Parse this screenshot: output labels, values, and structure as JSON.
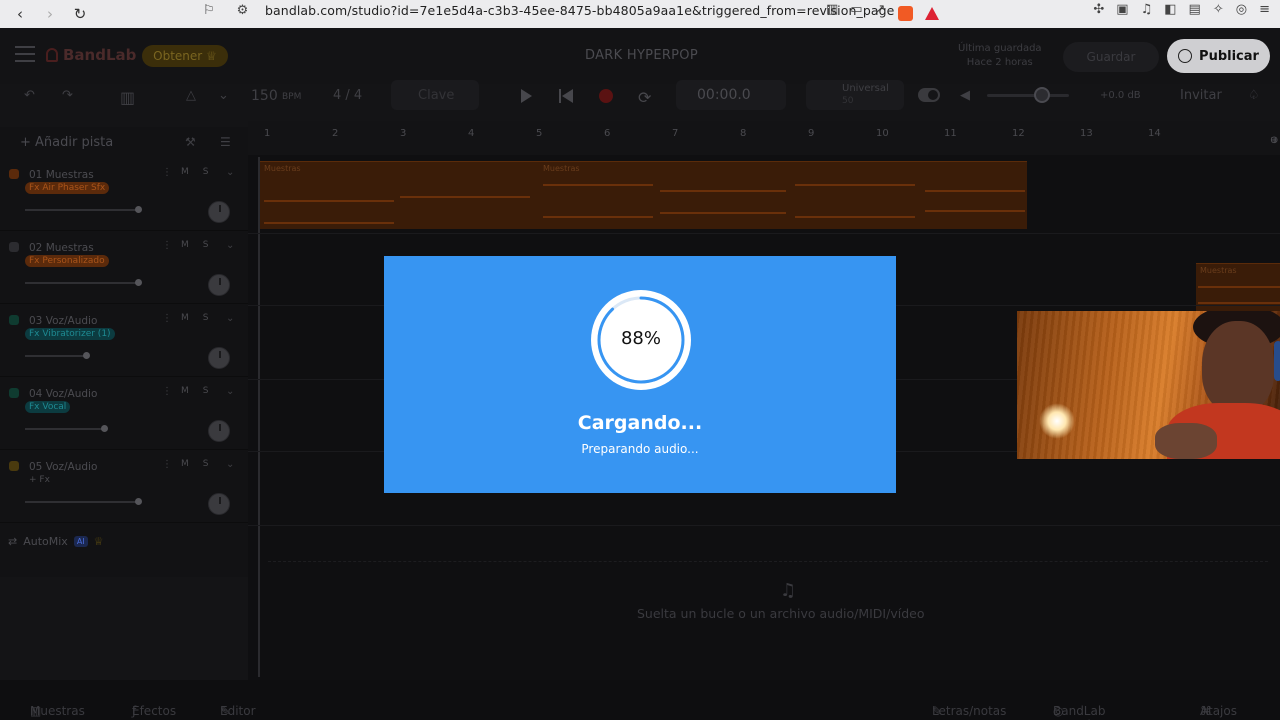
{
  "browser": {
    "url": "bandlab.com/studio?id=7e1e5d4a-c3b3-45ee-8475-bb4805a9aa1e&triggered_from=revision_page"
  },
  "header": {
    "logo": "BandLab",
    "get_label": "Obtener",
    "project_title": "DARK HYPERPOP",
    "saved_line1": "Última guardada",
    "saved_line2": "Hace 2 horas",
    "save_label": "Guardar",
    "publish_label": "Publicar"
  },
  "toolbar": {
    "tempo": "150",
    "tempo_unit": "BPM",
    "signature": "4 / 4",
    "key_label": "Clave",
    "time": "00:00.0",
    "tuner_label": "Universal",
    "tuner_value": "50",
    "volume_db": "+0.0 dB",
    "invite_label": "Invitar"
  },
  "tracks_panel": {
    "add_track_label": "Añadir pista",
    "tracks": [
      {
        "name": "01  Muestras",
        "fx": "Fx  Air Phaser Sfx",
        "fx_color": "#5b2a0b",
        "fx_text": "#a9541a",
        "icon_color": "#5b2a0b",
        "mute": "M",
        "solo": "S"
      },
      {
        "name": "02  Muestras",
        "fx": "Fx  Personalizado",
        "fx_color": "#5b2a0b",
        "fx_text": "#a9541a",
        "icon_color": "#2c2c30",
        "mute": "M",
        "solo": "S"
      },
      {
        "name": "03  Voz/Audio",
        "fx": "Fx  Vibratorizer (1)",
        "fx_color": "#0c3b40",
        "fx_text": "#1e8a92",
        "icon_color": "#0f3b30",
        "mute": "M",
        "solo": "S"
      },
      {
        "name": "04  Voz/Audio",
        "fx": "Fx  Vocal",
        "fx_color": "#0c3b40",
        "fx_text": "#1e8a92",
        "icon_color": "#0f3b30",
        "mute": "M",
        "solo": "S"
      },
      {
        "name": "05  Voz/Audio",
        "fx": "+ Fx",
        "fx_color": "transparent",
        "fx_text": "#4a4a4f",
        "icon_color": "#4a3a0e",
        "mute": "M",
        "solo": "S"
      }
    ],
    "automix_label": "AutoMix",
    "automix_badge": "AI"
  },
  "timeline": {
    "bars": [
      "1",
      "2",
      "3",
      "4",
      "5",
      "6",
      "7",
      "8",
      "9",
      "10",
      "11",
      "12",
      "13",
      "14"
    ],
    "clip_label": "Muestras",
    "drop_text": "Suelta un bucle o un archivo audio/MIDI/vídeo"
  },
  "bottom_bar": {
    "samples_label": "Muestras",
    "effects_label": "Efectos",
    "midi_label": "Editor MIDI",
    "lyrics_label": "Letras/notas",
    "sounds_label": "BandLab Sounds",
    "shortcuts_label": "Atajos"
  },
  "modal": {
    "percent": "88%",
    "progress": 0.88,
    "title": "Cargando...",
    "subtitle": "Preparando audio..."
  }
}
